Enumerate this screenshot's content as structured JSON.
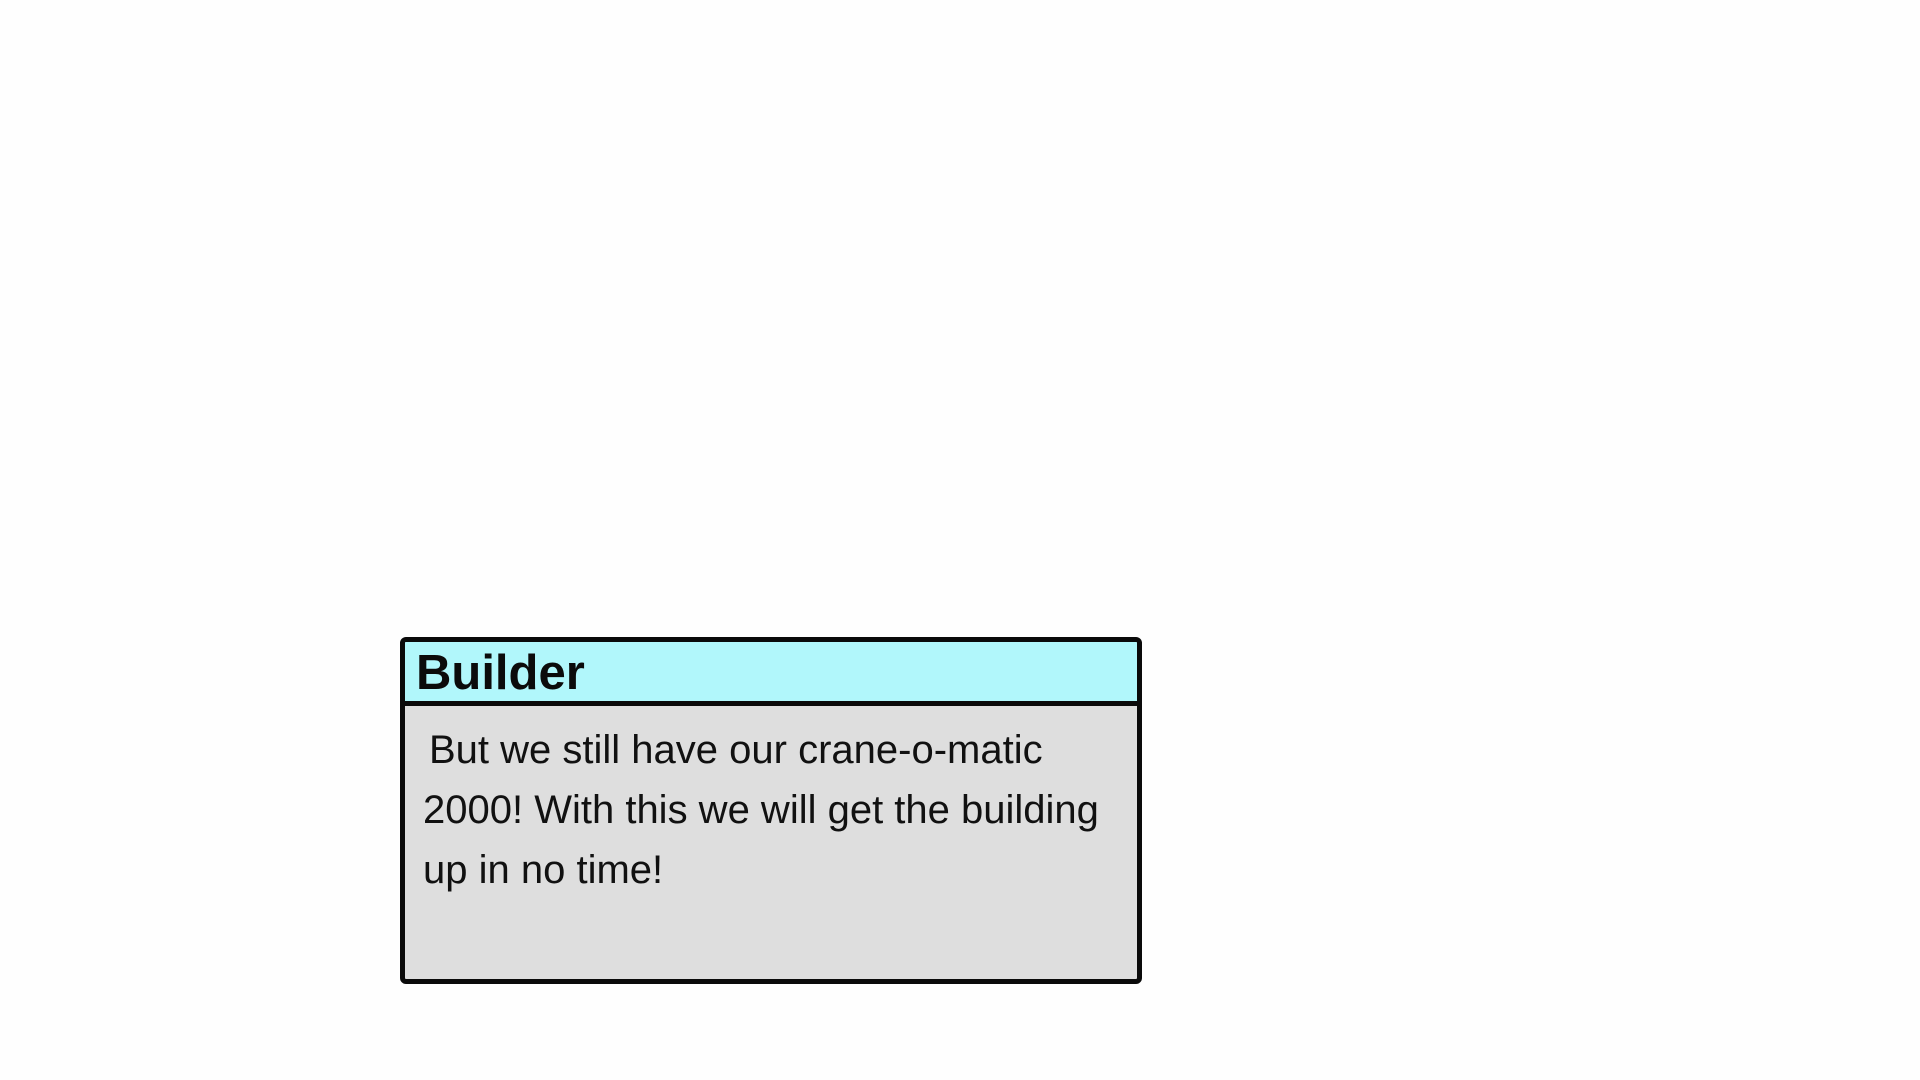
{
  "dialog": {
    "speaker": "Builder",
    "text": "But we still have our crane-o-matic 2000! With this we will get the building up in no time!"
  },
  "colors": {
    "background": "#fefefe",
    "speaker_bar": "#b1f7fb",
    "dialog_body": "#dedede",
    "border": "#0a0a0a"
  }
}
